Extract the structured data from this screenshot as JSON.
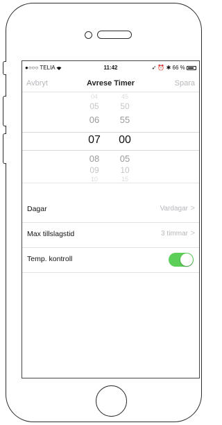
{
  "status_bar": {
    "carrier": "●○○○ TELIA",
    "wifi_icon": "wifi-icon",
    "time": "11:42",
    "right": "➶ ⏰ ✱ 66 %"
  },
  "nav": {
    "cancel": "Avbryt",
    "title": "Avrese Timer",
    "save": "Spara"
  },
  "picker": {
    "hours": [
      "04",
      "05",
      "06",
      "07",
      "08",
      "09",
      "10"
    ],
    "minutes": [
      "45",
      "50",
      "55",
      "00",
      "05",
      "10",
      "15"
    ],
    "selected_hour": "07",
    "selected_minute": "00"
  },
  "settings": {
    "days": {
      "label": "Dagar",
      "value": "Vardagar"
    },
    "max_time": {
      "label": "Max tillslagstid",
      "value": "3 timmar"
    },
    "temp": {
      "label": "Temp. kontroll",
      "enabled": true
    }
  },
  "colors": {
    "toggle_on": "#5ccf58",
    "muted": "#b7b7bd"
  }
}
